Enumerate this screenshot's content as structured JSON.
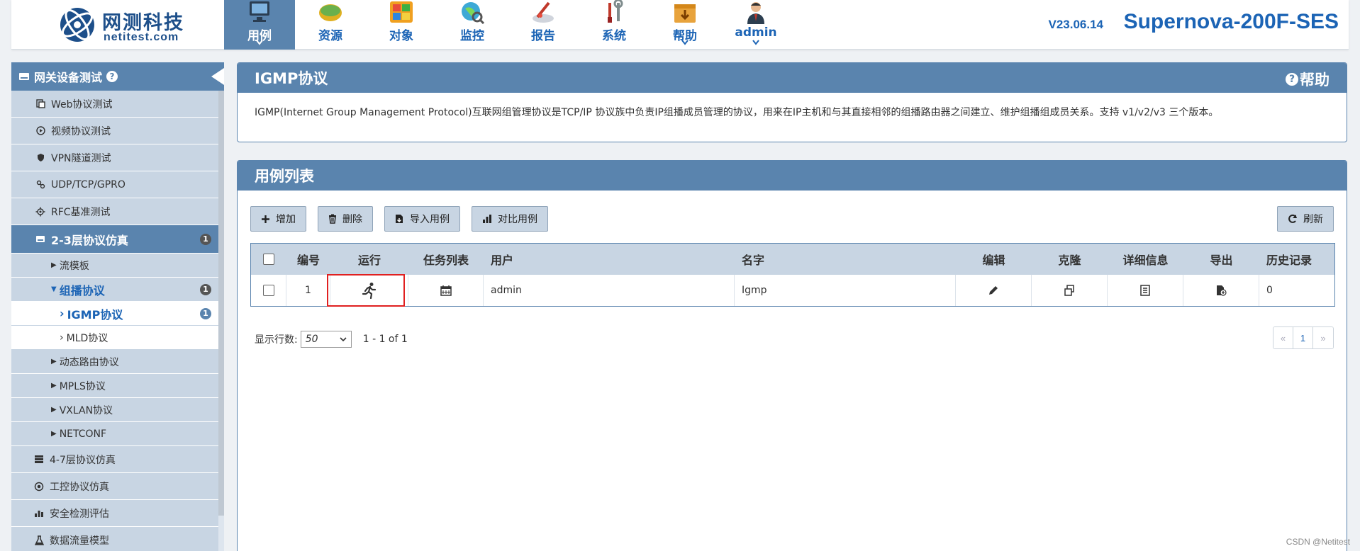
{
  "header": {
    "logo_cn": "网测科技",
    "logo_en": "netitest.com",
    "nav": [
      {
        "label": "用例",
        "icon": "monitor-icon",
        "active": true,
        "caret": true
      },
      {
        "label": "资源",
        "icon": "resource-icon",
        "active": false,
        "caret": false
      },
      {
        "label": "对象",
        "icon": "object-icon",
        "active": false,
        "caret": false
      },
      {
        "label": "监控",
        "icon": "monitor-globe-icon",
        "active": false,
        "caret": false
      },
      {
        "label": "报告",
        "icon": "report-icon",
        "active": false,
        "caret": false
      },
      {
        "label": "系统",
        "icon": "tools-icon",
        "active": false,
        "caret": false
      },
      {
        "label": "帮助",
        "icon": "help-box-icon",
        "active": false,
        "caret": true
      },
      {
        "label": "admin",
        "icon": "user-icon",
        "active": false,
        "caret": true
      }
    ],
    "version": "V23.06.14",
    "product": "Supernova-200F-SES"
  },
  "sidebar": {
    "title": "网关设备测试",
    "items": [
      {
        "label": "Web协议测试",
        "icon": "web-icon"
      },
      {
        "label": "视频协议测试",
        "icon": "video-icon"
      },
      {
        "label": "VPN隧道测试",
        "icon": "shield-icon"
      },
      {
        "label": "UDP/TCP/GPRO",
        "icon": "link-icon"
      },
      {
        "label": "RFC基准测试",
        "icon": "cog-icon"
      }
    ],
    "active_group": {
      "label": "2-3层协议仿真",
      "badge": "1"
    },
    "sub_items": [
      {
        "label": "流模板"
      },
      {
        "label": "组播协议",
        "badge": "1"
      }
    ],
    "subsub_items": [
      {
        "label": "IGMP协议",
        "badge": "1"
      },
      {
        "label": "MLD协议"
      }
    ],
    "sub_items_after": [
      {
        "label": "动态路由协议"
      },
      {
        "label": "MPLS协议"
      },
      {
        "label": "VXLAN协议"
      },
      {
        "label": "NETCONF"
      }
    ],
    "bottom_items": [
      {
        "label": "4-7层协议仿真",
        "icon": "server-icon"
      },
      {
        "label": "工控协议仿真",
        "icon": "target-icon"
      },
      {
        "label": "安全检测评估",
        "icon": "bars-icon"
      },
      {
        "label": "数据流量模型",
        "icon": "flask-icon"
      }
    ]
  },
  "info_panel": {
    "title": "IGMP协议",
    "help": "帮助",
    "description": "IGMP(Internet Group Management Protocol)互联网组管理协议是TCP/IP 协议族中负责IP组播成员管理的协议，用来在IP主机和与其直接相邻的组播路由器之间建立、维护组播组成员关系。支持 v1/v2/v3 三个版本。"
  },
  "case_panel": {
    "title": "用例列表",
    "buttons": {
      "add": "增加",
      "delete": "删除",
      "import": "导入用例",
      "compare": "对比用例",
      "refresh": "刷新"
    },
    "columns": {
      "id": "编号",
      "run": "运行",
      "tasks": "任务列表",
      "user": "用户",
      "name": "名字",
      "edit": "编辑",
      "clone": "克隆",
      "detail": "详细信息",
      "export": "导出",
      "history": "历史记录"
    },
    "rows": [
      {
        "id": "1",
        "user": "admin",
        "name": "Igmp",
        "history": "0"
      }
    ],
    "pager": {
      "rows_label": "显示行数:",
      "rows_value": "50",
      "range": "1 - 1 of 1",
      "first": "«",
      "page": "1",
      "last": "»"
    }
  },
  "watermark": "CSDN @Netitest",
  "colors": {
    "accent": "#5a84ae",
    "link": "#1c64b5",
    "panel_light": "#c8d5e3",
    "highlight": "#e02020"
  }
}
